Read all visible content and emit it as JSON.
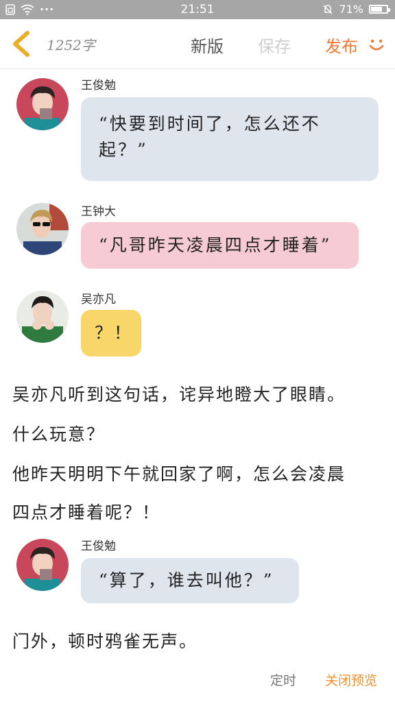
{
  "status_bar": {
    "time": "21:51",
    "battery": "71%",
    "dots": "···",
    "battery_level": 0.71
  },
  "toolbar": {
    "word_count": "1252字",
    "new_version": "新版",
    "save": "保存",
    "publish": "发布"
  },
  "chat": [
    {
      "name": "王俊勉",
      "text": "“快要到时间了，怎么还不起？”",
      "avatar": "boy-red-avatar",
      "color": "#dfe5ec"
    },
    {
      "name": "王钟大",
      "text": "“凡哥昨天凌晨四点才睡着”",
      "avatar": "boy-sunglasses-avatar",
      "color": "#f7cbd3"
    },
    {
      "name": "吴亦凡",
      "text": "？！",
      "avatar": "boy-green-avatar",
      "color": "#f9d66a"
    },
    {
      "name": "王俊勉",
      "text": "“算了，谁去叫他？”",
      "avatar": "boy-red-avatar",
      "color": "#dfe5ec"
    }
  ],
  "narration": {
    "line1": "吴亦凡听到这句话，诧异地瞪大了眼睛。",
    "line2": "什么玩意？",
    "line3": "他昨天明明下午就回家了啊，怎么会凌晨",
    "line4": "四点才睡着呢？！",
    "line5": "门外，顿时鸦雀无声。"
  },
  "footer": {
    "timer": "定时",
    "close_preview": "关闭预览"
  },
  "colors": {
    "accent_orange": "#f07a33",
    "status_bar_gray": "#a6a6a6",
    "back_arrow": "#e8b028"
  }
}
